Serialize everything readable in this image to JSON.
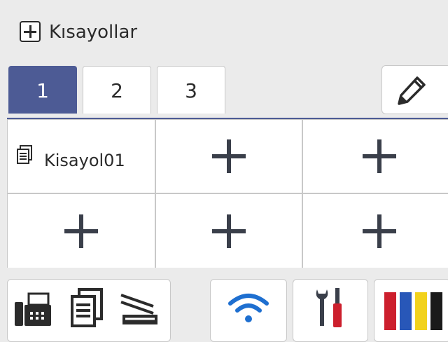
{
  "header": {
    "title": "Kısayollar",
    "icon": "add-box-icon"
  },
  "tabs": [
    {
      "label": "1",
      "active": true
    },
    {
      "label": "2",
      "active": false
    },
    {
      "label": "3",
      "active": false
    }
  ],
  "edit_button": {
    "icon": "pencil-icon"
  },
  "grid": {
    "cells": [
      {
        "type": "shortcut",
        "label": "Kisayol01",
        "icon": "document-icon"
      },
      {
        "type": "add",
        "icon": "plus-icon"
      },
      {
        "type": "add",
        "icon": "plus-icon"
      },
      {
        "type": "add",
        "icon": "plus-icon"
      },
      {
        "type": "add",
        "icon": "plus-icon"
      },
      {
        "type": "add",
        "icon": "plus-icon"
      }
    ]
  },
  "bottom_bar": {
    "mode_icons": [
      "fax-icon",
      "copy-icon",
      "scan-icon"
    ],
    "wifi_icon": "wifi-icon",
    "settings_icon": "tools-icon",
    "ink_colors": [
      "#cc1f2d",
      "#2857b8",
      "#f2d21c",
      "#1a1a1a"
    ],
    "accent_colors": {
      "active_tab": "#4d5b95",
      "wifi": "#1e6fd0",
      "screwdriver": "#cc1f2d"
    }
  }
}
